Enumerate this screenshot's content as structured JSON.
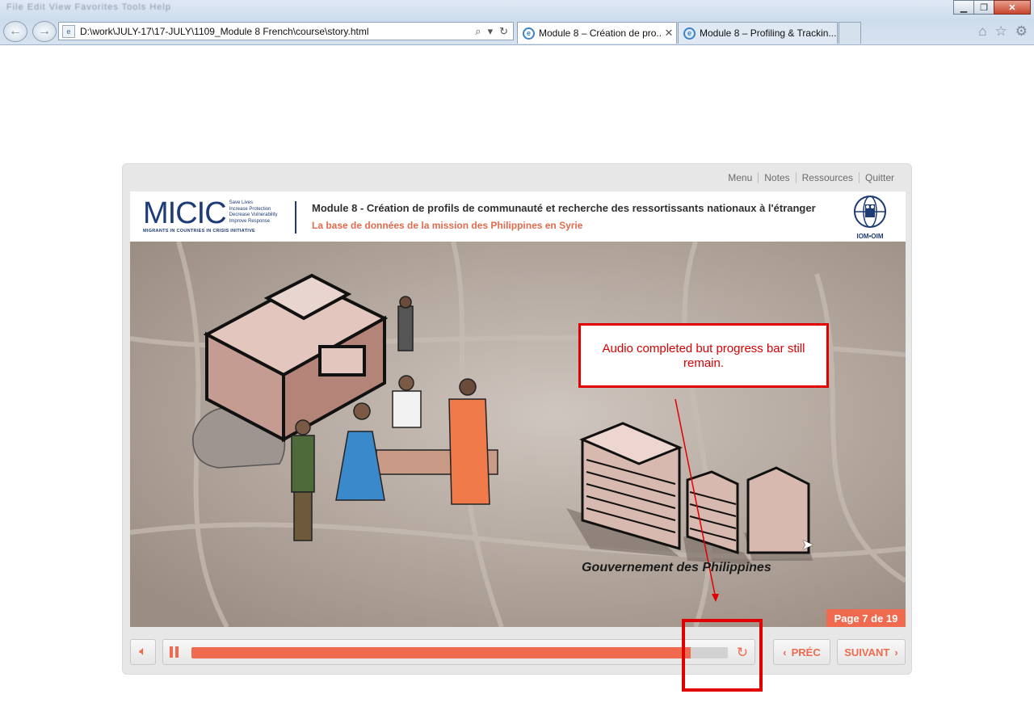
{
  "browser": {
    "menu_blur": "File  Edit  View  Favorites  Tools  Help",
    "address": "D:\\work\\JULY-17\\17-JULY\\1109_Module 8 French\\course\\story.html",
    "tabs": [
      {
        "label": "Module 8 – Création de pro...",
        "active": true
      },
      {
        "label": "Module 8 – Profiling & Trackin...",
        "active": false
      }
    ]
  },
  "player": {
    "top_links": [
      "Menu",
      "Notes",
      "Ressources",
      "Quitter"
    ],
    "logo": {
      "name": "MICIC",
      "tagline": [
        "Save Lives",
        "Increase Protection",
        "Decrease Vulnerability",
        "Improve Response"
      ],
      "subtitle": "MIGRANTS IN COUNTRIES IN CRISIS INITIATIVE"
    },
    "title": "Module 8 - Création de profils de communauté et recherche des ressortissants nationaux à l'étranger",
    "subtitle": "La base de données de la mission des Philippines en Syrie",
    "org_logo_text": "IOM•OIM",
    "scene_label": "Gouvernement des Philippines",
    "page_indicator": "Page 7 de 19",
    "progress": 0.93,
    "prev_label": "PRÉC",
    "next_label": "SUIVANT"
  },
  "annotation": {
    "text": "Audio completed but progress bar still remain."
  },
  "colors": {
    "accent": "#ef6a4f",
    "brand_blue": "#1d3b77",
    "annotation_red": "#e00000"
  }
}
